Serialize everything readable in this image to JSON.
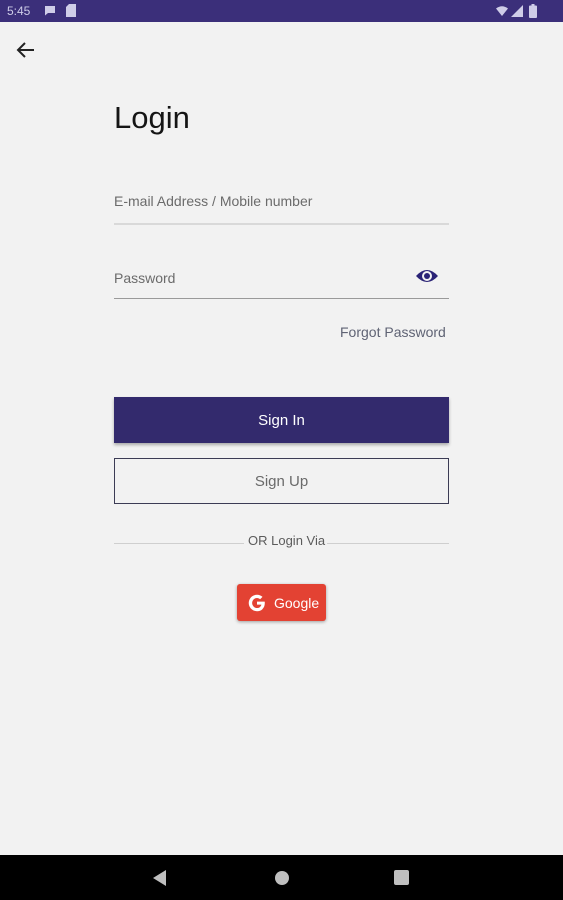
{
  "status_bar": {
    "time": "5:45",
    "icons": [
      "message-icon",
      "sd-card-icon",
      "wifi-icon",
      "signal-icon",
      "battery-icon"
    ]
  },
  "header": {
    "back_icon": "arrow-left-icon"
  },
  "form": {
    "title": "Login",
    "email": {
      "placeholder": "E-mail Address / Mobile number",
      "value": ""
    },
    "password": {
      "placeholder": "Password",
      "value": "",
      "toggle_icon": "eye-icon"
    },
    "forgot_password": "Forgot Password",
    "sign_in": "Sign In",
    "sign_up": "Sign Up",
    "divider_text": "OR Login Via",
    "google_button": "Google"
  },
  "colors": {
    "status_bar": "#3b2f7a",
    "primary": "#332a6d",
    "google": "#e34233",
    "background": "#f2f2f2"
  },
  "nav_bar": {
    "icons": [
      "nav-back-icon",
      "nav-home-icon",
      "nav-recents-icon"
    ]
  }
}
